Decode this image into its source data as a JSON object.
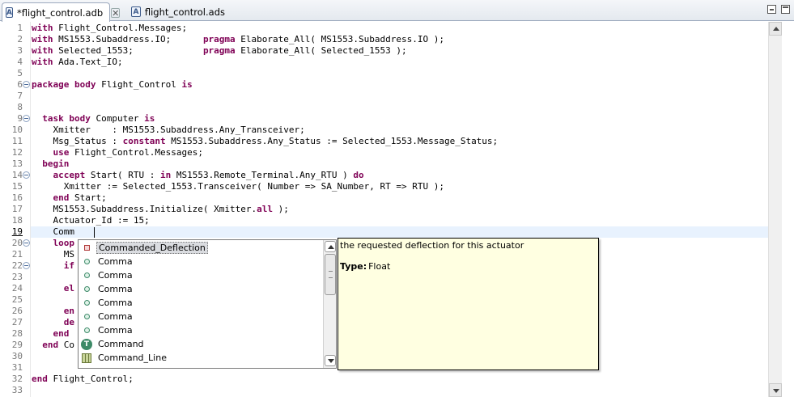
{
  "tabs": [
    {
      "label": "*flight_control.adb",
      "icon": "ada-file-icon",
      "active": true
    },
    {
      "label": "flight_control.ads",
      "icon": "ada-file-icon",
      "active": false
    }
  ],
  "tab_close_glyph": "✕",
  "tab_icon_glyph": "A",
  "editor": {
    "current_line": 19,
    "lines": [
      {
        "n": "1",
        "tokens": [
          {
            "t": "with",
            "kw": true
          },
          {
            "t": " Flight_Control.Messages;"
          }
        ]
      },
      {
        "n": "2",
        "tokens": [
          {
            "t": "with",
            "kw": true
          },
          {
            "t": " MS1553.Subaddress.IO;      "
          },
          {
            "t": "pragma",
            "kw": true
          },
          {
            "t": " Elaborate_All( MS1553.Subaddress.IO );"
          }
        ]
      },
      {
        "n": "3",
        "tokens": [
          {
            "t": "with",
            "kw": true
          },
          {
            "t": " Selected_1553;             "
          },
          {
            "t": "pragma",
            "kw": true
          },
          {
            "t": " Elaborate_All( Selected_1553 );"
          }
        ]
      },
      {
        "n": "4",
        "tokens": [
          {
            "t": "with",
            "kw": true
          },
          {
            "t": " Ada.Text_IO;"
          }
        ]
      },
      {
        "n": "5",
        "tokens": []
      },
      {
        "n": "6",
        "fold": true,
        "tokens": [
          {
            "t": "package",
            "kw": true
          },
          {
            "t": " "
          },
          {
            "t": "body",
            "kw": true
          },
          {
            "t": " Flight_Control "
          },
          {
            "t": "is",
            "kw": true
          }
        ]
      },
      {
        "n": "7",
        "tokens": []
      },
      {
        "n": "8",
        "tokens": []
      },
      {
        "n": "9",
        "fold": true,
        "tokens": [
          {
            "t": "  "
          },
          {
            "t": "task",
            "kw": true
          },
          {
            "t": " "
          },
          {
            "t": "body",
            "kw": true
          },
          {
            "t": " Computer "
          },
          {
            "t": "is",
            "kw": true
          }
        ]
      },
      {
        "n": "10",
        "tokens": [
          {
            "t": "    Xmitter    : MS1553.Subaddress.Any_Transceiver;"
          }
        ]
      },
      {
        "n": "11",
        "tokens": [
          {
            "t": "    Msg_Status : "
          },
          {
            "t": "constant",
            "kw": true
          },
          {
            "t": " MS1553.Subaddress.Any_Status := Selected_1553.Message_Status;"
          }
        ]
      },
      {
        "n": "12",
        "tokens": [
          {
            "t": "    "
          },
          {
            "t": "use",
            "kw": true
          },
          {
            "t": " Flight_Control.Messages;"
          }
        ]
      },
      {
        "n": "13",
        "tokens": [
          {
            "t": "  "
          },
          {
            "t": "begin",
            "kw": true
          }
        ]
      },
      {
        "n": "14",
        "fold": true,
        "tokens": [
          {
            "t": "    "
          },
          {
            "t": "accept",
            "kw": true
          },
          {
            "t": " Start( RTU : "
          },
          {
            "t": "in",
            "kw": true
          },
          {
            "t": " MS1553.Remote_Terminal.Any_RTU ) "
          },
          {
            "t": "do",
            "kw": true
          }
        ]
      },
      {
        "n": "15",
        "tokens": [
          {
            "t": "      Xmitter := Selected_1553.Transceiver( Number => SA_Number, RT => RTU );"
          }
        ]
      },
      {
        "n": "16",
        "tokens": [
          {
            "t": "    "
          },
          {
            "t": "end",
            "kw": true
          },
          {
            "t": " Start;"
          }
        ]
      },
      {
        "n": "17",
        "tokens": [
          {
            "t": "    MS1553.Subaddress.Initialize( Xmitter."
          },
          {
            "t": "all",
            "kw": true
          },
          {
            "t": " );"
          }
        ]
      },
      {
        "n": "18",
        "tokens": [
          {
            "t": "    Actuator_Id := 15;"
          }
        ]
      },
      {
        "n": "19",
        "tokens": [
          {
            "t": "    Comm"
          }
        ]
      },
      {
        "n": "20",
        "fold": true,
        "tokens": [
          {
            "t": "    "
          },
          {
            "t": "loop",
            "kw": true
          }
        ]
      },
      {
        "n": "21",
        "tokens": [
          {
            "t": "      MS"
          }
        ]
      },
      {
        "n": "22",
        "fold": true,
        "tokens": [
          {
            "t": "      "
          },
          {
            "t": "if",
            "kw": true
          }
        ]
      },
      {
        "n": "23",
        "tokens": []
      },
      {
        "n": "24",
        "tokens": [
          {
            "t": "      "
          },
          {
            "t": "el",
            "kw": true
          }
        ]
      },
      {
        "n": "25",
        "tokens": []
      },
      {
        "n": "26",
        "tokens": [
          {
            "t": "      "
          },
          {
            "t": "en",
            "kw": true
          }
        ]
      },
      {
        "n": "27",
        "tokens": [
          {
            "t": "      "
          },
          {
            "t": "de",
            "kw": true
          }
        ]
      },
      {
        "n": "28",
        "tokens": [
          {
            "t": "    "
          },
          {
            "t": "end",
            "kw": true
          }
        ]
      },
      {
        "n": "29",
        "tokens": [
          {
            "t": "  "
          },
          {
            "t": "end",
            "kw": true
          },
          {
            "t": " Co"
          }
        ]
      },
      {
        "n": "30",
        "tokens": []
      },
      {
        "n": "31",
        "tokens": []
      },
      {
        "n": "32",
        "tokens": [
          {
            "t": "end",
            "kw": true
          },
          {
            "t": " Flight_Control;"
          }
        ]
      },
      {
        "n": "33",
        "tokens": []
      }
    ]
  },
  "completion": {
    "selected_index": 0,
    "items": [
      {
        "label": "Commanded_Deflection",
        "icon": "field-icon",
        "kind": "field"
      },
      {
        "label": "Comma",
        "icon": "literal-icon",
        "kind": "literal"
      },
      {
        "label": "Comma",
        "icon": "literal-icon",
        "kind": "literal"
      },
      {
        "label": "Comma",
        "icon": "literal-icon",
        "kind": "literal"
      },
      {
        "label": "Comma",
        "icon": "literal-icon",
        "kind": "literal"
      },
      {
        "label": "Comma",
        "icon": "literal-icon",
        "kind": "literal"
      },
      {
        "label": "Comma",
        "icon": "literal-icon",
        "kind": "literal"
      },
      {
        "label": "Command",
        "icon": "type-icon",
        "kind": "type",
        "glyph": "T"
      },
      {
        "label": "Command_Line",
        "icon": "package-icon",
        "kind": "record"
      }
    ]
  },
  "doc_popup": {
    "description": "the requested deflection for this actuator",
    "type_label": "Type:",
    "type_value": "Float"
  },
  "colors": {
    "keyword": "#7f0055",
    "current_line": "#e8f2fe",
    "doc_background": "#ffffe1"
  }
}
